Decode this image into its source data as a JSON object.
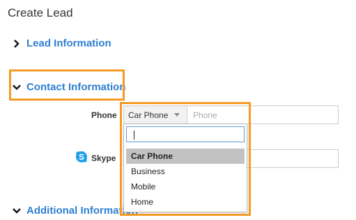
{
  "page": {
    "title": "Create Lead"
  },
  "sections": {
    "lead_information": {
      "label": "Lead Information",
      "expanded": false
    },
    "contact_information": {
      "label": "Contact Information",
      "expanded": true
    },
    "additional_information": {
      "label": "Additional Information",
      "expanded": true
    }
  },
  "contact_form": {
    "phone": {
      "label": "Phone",
      "type_selected": "Car Phone",
      "number_placeholder": "Phone",
      "number_value": ""
    },
    "skype": {
      "label": "Skype",
      "icon": "skype-icon",
      "value": ""
    }
  },
  "phone_type_dropdown": {
    "open": true,
    "search_value": "",
    "options": [
      "Car Phone",
      "Business",
      "Mobile",
      "Home"
    ],
    "highlighted": "Car Phone"
  },
  "colors": {
    "link_blue": "#2f7fd1",
    "highlight_orange": "#f59a23",
    "selected_option_bg": "#c2c2c2"
  }
}
